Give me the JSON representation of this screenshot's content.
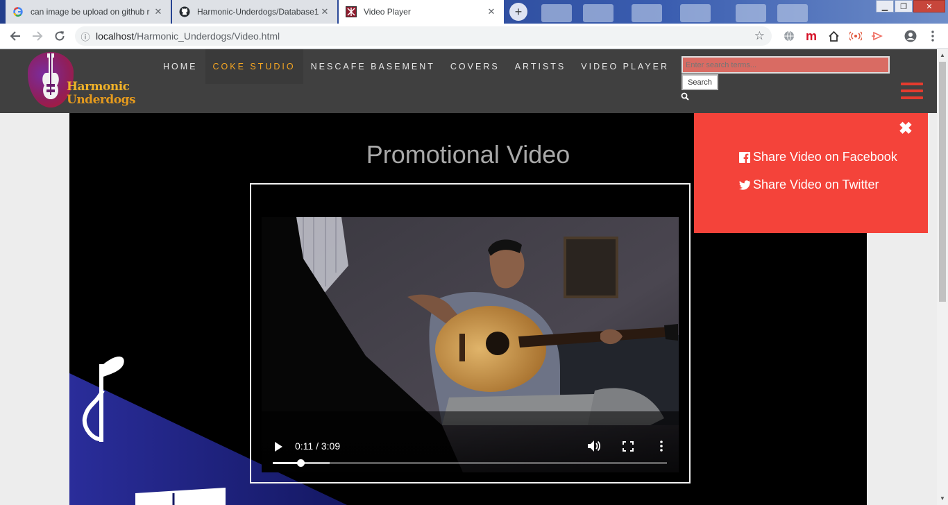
{
  "browser": {
    "tabs": [
      {
        "title": "can image be upload on github r",
        "favicon": "google-icon",
        "active": false
      },
      {
        "title": "Harmonic-Underdogs/Database1",
        "favicon": "github-icon",
        "active": false
      },
      {
        "title": "Video Player",
        "favicon": "site-icon",
        "active": true
      }
    ],
    "new_tab_label": "+",
    "url_host": "localhost",
    "url_path": "/Harmonic_Underdogs/Video.html"
  },
  "site": {
    "logo_line1": "Harmonic",
    "logo_line2": "Underdogs",
    "nav": [
      "HOME",
      "COKE STUDIO",
      "NESCAFE BASEMENT",
      "COVERS",
      "ARTISTS",
      "VIDEO PLAYER"
    ],
    "nav_active": "COKE STUDIO",
    "search_placeholder": "Enter search terms...",
    "search_button": "Search",
    "accent_color": "#f5a623",
    "brand_red": "#f4433a"
  },
  "main": {
    "title": "Promotional Video",
    "video": {
      "current_time": "0:11",
      "duration": "3:09",
      "time_display": "0:11 / 3:09",
      "progress_fraction": 0.07,
      "buffered_fraction": 0.145
    }
  },
  "share": {
    "facebook_label": "Share Video on Facebook",
    "twitter_label": "Share Video on Twitter"
  }
}
